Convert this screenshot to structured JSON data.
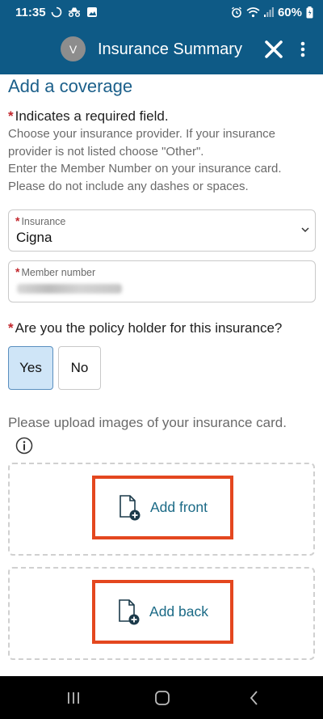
{
  "status_bar": {
    "time": "11:35",
    "battery": "60%"
  },
  "app_bar": {
    "avatar_initial": "V",
    "title": "Insurance Summary"
  },
  "form": {
    "section_title": "Add a coverage",
    "required_star": "*",
    "required_note": "Indicates a required field.",
    "helper_lines": [
      "Choose your insurance provider. If your insurance",
      "provider is not listed choose \"Other\".",
      "Enter the Member Number on your insurance card.",
      "Please do not include any dashes or spaces."
    ],
    "insurance": {
      "label": "Insurance",
      "value": "Cigna"
    },
    "member_number": {
      "label": "Member number"
    },
    "policy_question": "Are you the policy holder for this insurance?",
    "policy_options": {
      "yes": "Yes",
      "no": "No",
      "selected": "Yes"
    },
    "upload_prompt": "Please upload images of your insurance card.",
    "add_front": "Add front",
    "add_back": "Add back"
  },
  "colors": {
    "header_bg": "#0e5a86",
    "title_blue": "#1b5f8a",
    "required_red": "#c2272d",
    "selected_bg": "#cfe5f7",
    "highlight_border": "#e4471f",
    "link_teal": "#1b6a86"
  },
  "icons": {
    "close": "close-icon",
    "more": "more-vertical-icon",
    "info": "info-icon",
    "doc_add": "document-add-icon",
    "chevron": "chevron-down-icon"
  }
}
